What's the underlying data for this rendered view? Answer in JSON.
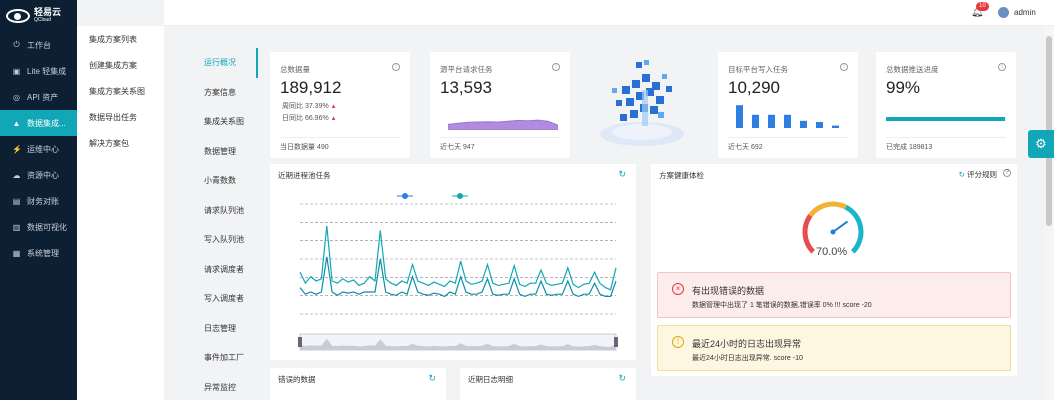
{
  "brand": {
    "name": "轻易云",
    "sub": "QCloud"
  },
  "sidebar": {
    "items": [
      {
        "label": "工作台",
        "icon": "power-icon"
      },
      {
        "label": "Lite 轻集成",
        "icon": "box-icon"
      },
      {
        "label": "API 资产",
        "icon": "compass-icon"
      },
      {
        "label": "数据集成...",
        "icon": "chart-icon"
      },
      {
        "label": "运维中心",
        "icon": "bolt-icon"
      },
      {
        "label": "资源中心",
        "icon": "cloud-icon"
      },
      {
        "label": "财务对账",
        "icon": "ledger-icon"
      },
      {
        "label": "数据可视化",
        "icon": "bar-icon"
      },
      {
        "label": "系统管理",
        "icon": "grid-icon"
      }
    ]
  },
  "submenu": {
    "items": [
      "集成方案列表",
      "创建集成方案",
      "集成方案关系图",
      "数据导出任务",
      "解决方案包"
    ]
  },
  "header": {
    "notifications": "10",
    "user": "admin"
  },
  "tabs": [
    "运行概况",
    "方案信息",
    "集成关系图",
    "数据管理",
    "小青数数",
    "请求队列池",
    "写入队列池",
    "请求调度者",
    "写入调度者",
    "日志管理",
    "事件加工厂",
    "异常监控"
  ],
  "stats": {
    "total": {
      "title": "总数据量",
      "value": "189,912",
      "weekly": "周同比 37.39%",
      "daily": "日同比 66.96%",
      "today": "当日数据量 490"
    },
    "source": {
      "title": "源平台请求任务",
      "value": "13,593",
      "foot": "近七天 947",
      "spark": [
        0.35,
        0.42,
        0.48,
        0.5,
        0.52,
        0.5,
        0.55,
        0.6,
        0.58,
        0.62,
        0.55,
        0.3
      ]
    },
    "target": {
      "title": "目标平台写入任务",
      "value": "10,290",
      "foot": "近七天 692",
      "bars": [
        0.95,
        0.55,
        0.55,
        0.55,
        0.3,
        0.25,
        0.1
      ]
    },
    "progress": {
      "title": "总数据推送进度",
      "value": "99%",
      "foot": "已完成 189813",
      "percent": 99
    }
  },
  "chart_panel": {
    "title": "近期进程池任务"
  },
  "health": {
    "title": "方案健康体检",
    "rules": "评分规则",
    "gauge": "70.0%",
    "gauge_value": 70.0
  },
  "alerts": [
    {
      "title": "有出现错误的数据",
      "desc": "数据管理中出现了 1 笔错误的数据,错误率 0% !!! score -20",
      "bg": "#fdecec",
      "border": "#f5c2c2",
      "icon_color": "#e4393c"
    },
    {
      "title": "最近24小时的日志出现异常",
      "desc": "最近24小时日志出现异常. score -10",
      "bg": "#fdf6e0",
      "border": "#f3df9c",
      "icon_color": "#e0a800"
    }
  ],
  "bottom_panels": [
    {
      "title": "错误的数据"
    },
    {
      "title": "近期日志明细"
    }
  ],
  "chart_data": {
    "type": "line",
    "series": [
      {
        "values": [
          0.62,
          0.72,
          0.66,
          0.7,
          0.68,
          0.2,
          0.7,
          0.72,
          0.68,
          0.71,
          0.69,
          0.74,
          0.72,
          0.66,
          0.7,
          0.24,
          0.68,
          0.72,
          0.74,
          0.7,
          0.72,
          0.55,
          0.7,
          0.72,
          0.74,
          0.71,
          0.73,
          0.75,
          0.7,
          0.72,
          0.52,
          0.7,
          0.73,
          0.72,
          0.7,
          0.55,
          0.72,
          0.74,
          0.73,
          0.72,
          0.56,
          0.73,
          0.75,
          0.72,
          0.72,
          0.6,
          0.72,
          0.74,
          0.73,
          0.72,
          0.58,
          0.73,
          0.76,
          0.73,
          0.72,
          0.62,
          0.72,
          0.76,
          0.78,
          0.58
        ],
        "color": "#11a7b7"
      },
      {
        "values": [
          0.76,
          0.82,
          0.8,
          0.82,
          0.8,
          0.48,
          0.8,
          0.83,
          0.8,
          0.81,
          0.8,
          0.82,
          0.8,
          0.8,
          0.8,
          0.5,
          0.8,
          0.82,
          0.83,
          0.8,
          0.82,
          0.66,
          0.8,
          0.82,
          0.83,
          0.81,
          0.82,
          0.84,
          0.8,
          0.82,
          0.66,
          0.8,
          0.82,
          0.82,
          0.8,
          0.68,
          0.82,
          0.83,
          0.82,
          0.82,
          0.68,
          0.82,
          0.84,
          0.82,
          0.82,
          0.7,
          0.82,
          0.83,
          0.82,
          0.82,
          0.7,
          0.82,
          0.84,
          0.82,
          0.82,
          0.72,
          0.82,
          0.84,
          0.84,
          0.7
        ],
        "color": "#0b8fa8"
      }
    ]
  }
}
